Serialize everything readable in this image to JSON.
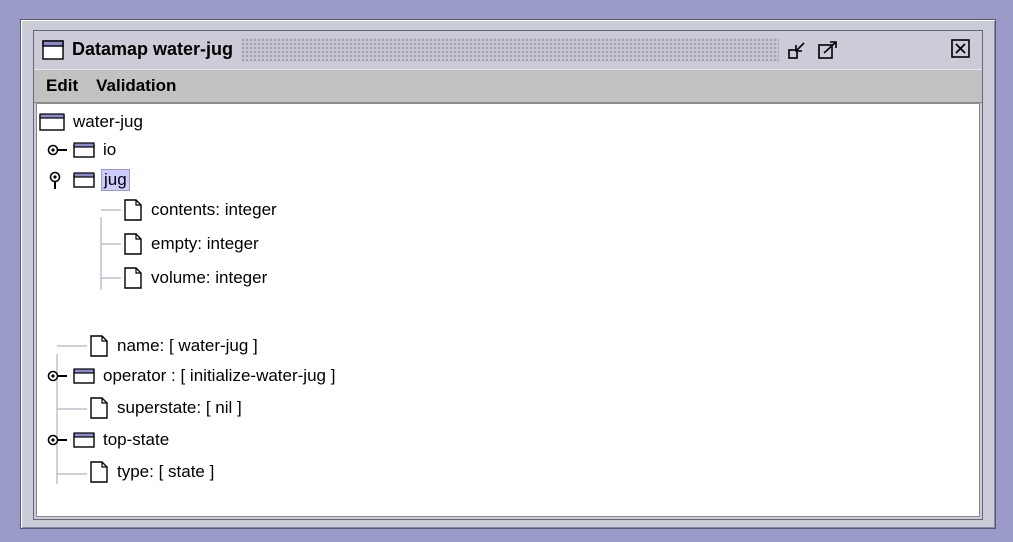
{
  "window": {
    "title": "Datamap water-jug"
  },
  "menu": {
    "items": [
      "Edit",
      "Validation"
    ]
  },
  "tree": {
    "root": "water-jug",
    "nodes": {
      "io": "io",
      "jug": "jug",
      "contents": "contents: integer",
      "empty": "empty: integer",
      "volume": "volume: integer",
      "name": "name: [ water-jug ]",
      "operator": "operator : [ initialize-water-jug ]",
      "superstate": "superstate: [ nil ]",
      "top_state": "top-state",
      "type": "type: [ state ]"
    },
    "selected": "jug"
  },
  "icons": {
    "window": "window-icon",
    "iconify": "iconify-icon",
    "maximize": "maximize-icon",
    "close": "close-icon",
    "folder": "folder-icon",
    "file": "file-icon",
    "expand": "expand-handle-icon",
    "collapse": "collapse-handle-icon"
  },
  "colors": {
    "desktop": "#9a9ac8",
    "selection": "#ccccff",
    "menubar": "#c2c2c2"
  }
}
